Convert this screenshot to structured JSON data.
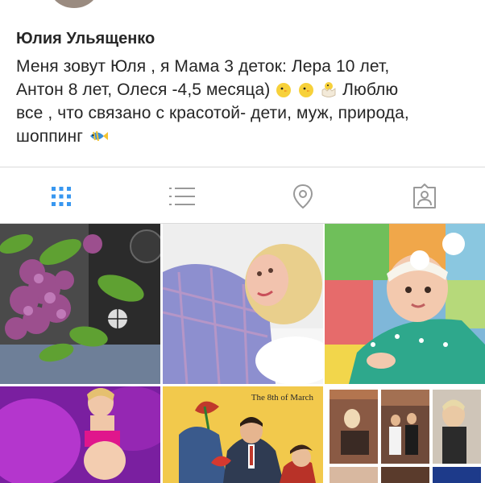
{
  "profile": {
    "name": "Юлия Ульященко",
    "bio_lines": [
      "Меня зовут Юля , я Мама 3 деток: Лера 10 лет,",
      "Антон 8 лет, Олеся -4,5 месяца)",
      "Люблю",
      "все , что связано с красотой- дети, муж, природа,",
      "шоппинг"
    ]
  },
  "tabs": [
    {
      "name": "grid-view",
      "icon": "grid-icon",
      "active": true
    },
    {
      "name": "list-view",
      "icon": "list-icon",
      "active": false
    },
    {
      "name": "places",
      "icon": "location-pin-icon",
      "active": false
    },
    {
      "name": "tagged",
      "icon": "tagged-person-icon",
      "active": false
    }
  ],
  "posts": [
    {
      "id": "lilac",
      "caption": ""
    },
    {
      "id": "woman-lying",
      "caption": ""
    },
    {
      "id": "baby-on-mat",
      "caption": ""
    },
    {
      "id": "pregnant-purple",
      "caption": ""
    },
    {
      "id": "march-card",
      "caption": "The 8th of March"
    },
    {
      "id": "collage",
      "caption": ""
    }
  ],
  "colors": {
    "active_tab": "#3897f0",
    "inactive_tab": "#999999",
    "divider": "#dbdbdb"
  }
}
